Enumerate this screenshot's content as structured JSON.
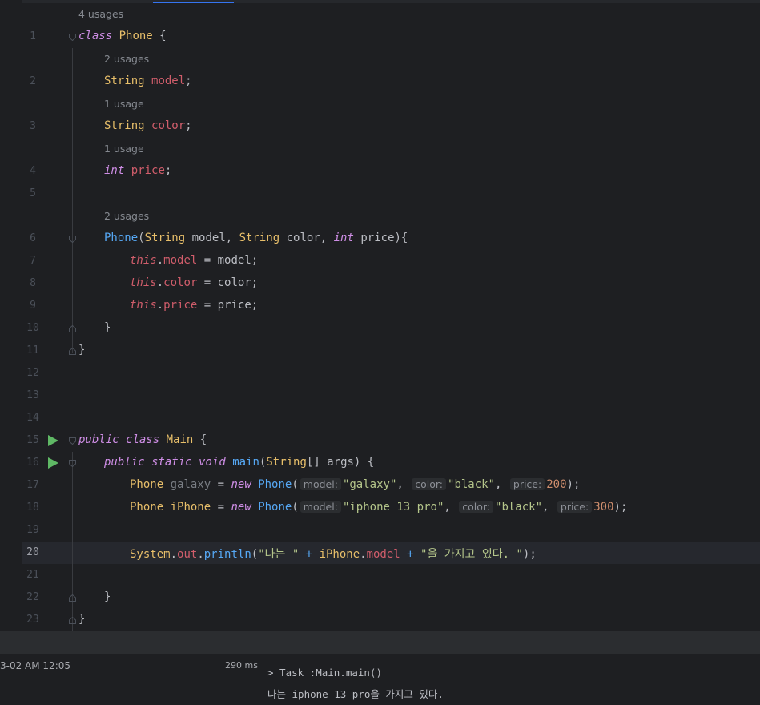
{
  "editor": {
    "usages": {
      "phone_class": "4 usages",
      "model": "2 usages",
      "color": "1 usage",
      "price": "1 usage",
      "ctor": "2 usages"
    },
    "line_numbers": [
      "1",
      "2",
      "3",
      "4",
      "5",
      "6",
      "7",
      "8",
      "9",
      "10",
      "11",
      "12",
      "13",
      "14",
      "15",
      "16",
      "17",
      "18",
      "19",
      "20",
      "21",
      "22",
      "23"
    ],
    "current_line": "20",
    "tokens": {
      "class_kw": "class",
      "phone": "Phone",
      "brace_open": " {",
      "string_type": "String",
      "model": "model",
      "color": "color",
      "int_kw": "int",
      "price": "price",
      "semicolon": ";",
      "this_kw": "this",
      "public_kw": "public",
      "static_kw": "static",
      "void_kw": "void",
      "main_cls": "Main",
      "main_fn": "main",
      "new_kw": "new",
      "galaxy": "galaxy",
      "iphone": "iPhone",
      "system": "System",
      "out": "out",
      "println": "println",
      "ctor_params": "(String model, String color, int price){",
      "main_args": "(String[] args) {",
      "close": "}"
    },
    "hints": {
      "model": "model:",
      "color": "color:",
      "price": "price:"
    },
    "literals": {
      "galaxy": "\"galaxy\"",
      "black": "\"black\"",
      "iphone13pro": "\"iphone 13 pro\"",
      "n200": "200",
      "n300": "300",
      "str_a": "\"나는 \"",
      "str_b": "\"을 가지고 있다. \""
    }
  },
  "run": {
    "timestamp": "3-02 AM 12:05",
    "duration": "290 ms",
    "task_line": "> Task :Main.main()",
    "output_line": "나는 iphone 13 pro을 가지고 있다."
  }
}
